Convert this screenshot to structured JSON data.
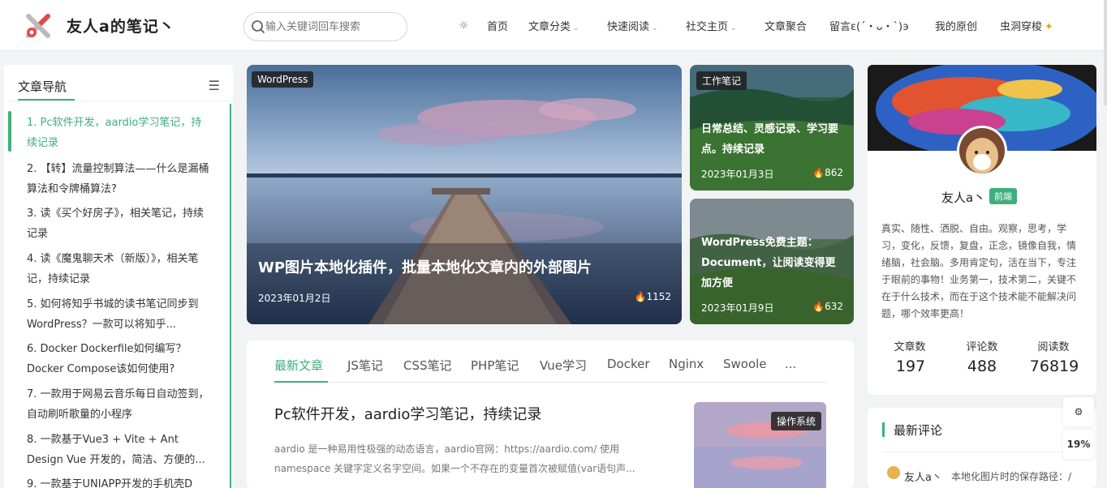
{
  "header": {
    "title": "友人a的笔记丶",
    "search_placeholder": "输入关键词回车搜索",
    "nav": [
      {
        "label": "首页",
        "chevron": false
      },
      {
        "label": "文章分类",
        "chevron": true
      },
      {
        "label": "快速阅读",
        "chevron": true
      },
      {
        "label": "社交主页",
        "chevron": true
      },
      {
        "label": "文章聚合",
        "chevron": false
      },
      {
        "label": "留言ε(´・ᴗ・`)϶",
        "chevron": false
      },
      {
        "label": "我的原创",
        "chevron": false
      },
      {
        "label": "虫洞穿梭",
        "chevron": false
      }
    ]
  },
  "toc": {
    "heading": "文章导航",
    "items": [
      "1. Pc软件开发，aardio学习笔记，持续记录",
      "2. 【转】流量控制算法——什么是漏桶算法和令牌桶算法?",
      "3. 读《买个好房子》，相关笔记，持续记录",
      "4. 读《魔鬼聊天术（新版）》，相关笔记，持续记录",
      "5. 如何将知乎书城的读书笔记同步到WordPress？一款可以将知乎...",
      "6. Docker Dockerfile如何编写？Docker Compose该如何使用?",
      "7. 一款用于网易云音乐每日自动签到，自动刷听歌量的小程序",
      "8. 一款基于Vue3 + Vite + Ant Design Vue 开发的，简洁、方便的...",
      "9. 一款基于UNIAPP开发的手机壳D"
    ]
  },
  "hero": {
    "tag": "WordPress",
    "title": "WP图片本地化插件，批量本地化文章内的外部图片",
    "date": "2023年01月2日",
    "views": "1152"
  },
  "side_cards": [
    {
      "tag": "工作笔记",
      "title": "日常总结、灵感记录、学习要点。持续记录",
      "date": "2023年01月3日",
      "views": "862"
    },
    {
      "tag": "",
      "title": "WordPress免费主题：Document，让阅读变得更加方便",
      "date": "2023年01月9日",
      "views": "632"
    }
  ],
  "content": {
    "tabs": [
      "最新文章",
      "JS笔记",
      "CSS笔记",
      "PHP笔记",
      "Vue学习",
      "Docker",
      "Nginx",
      "Swoole",
      "..."
    ],
    "post": {
      "title": "Pc软件开发，aardio学习笔记，持续记录",
      "excerpt": "aardio 是一种易用性极强的动态语言，aardio官网：https://aardio.com/ 使用 namespace 关键字定义名字空间。如果一个不存在的变量首次被赋值(var语句声...",
      "tag": "操作系统"
    }
  },
  "profile": {
    "name": "友人a丶",
    "badge": "前端",
    "bio": "真实、随性、洒脱、自由。观察，思考，学习，变化，反馈，复盘，正念，镜像自我，情绪脑，社会脑。多用肯定句，活在当下，专注于眼前的事物！业务第一，技术第二，关键不在于什么技术，而在于这个技术能不能解决问题，哪个效率更高！",
    "stats": [
      {
        "label": "文章数",
        "value": "197"
      },
      {
        "label": "评论数",
        "value": "488"
      },
      {
        "label": "阅读数",
        "value": "76819"
      }
    ]
  },
  "comments": {
    "heading": "最新评论",
    "first": {
      "name": "友人a丶",
      "text": "本地化图片时的保存路径：/"
    }
  },
  "float": {
    "progress": "19%"
  }
}
